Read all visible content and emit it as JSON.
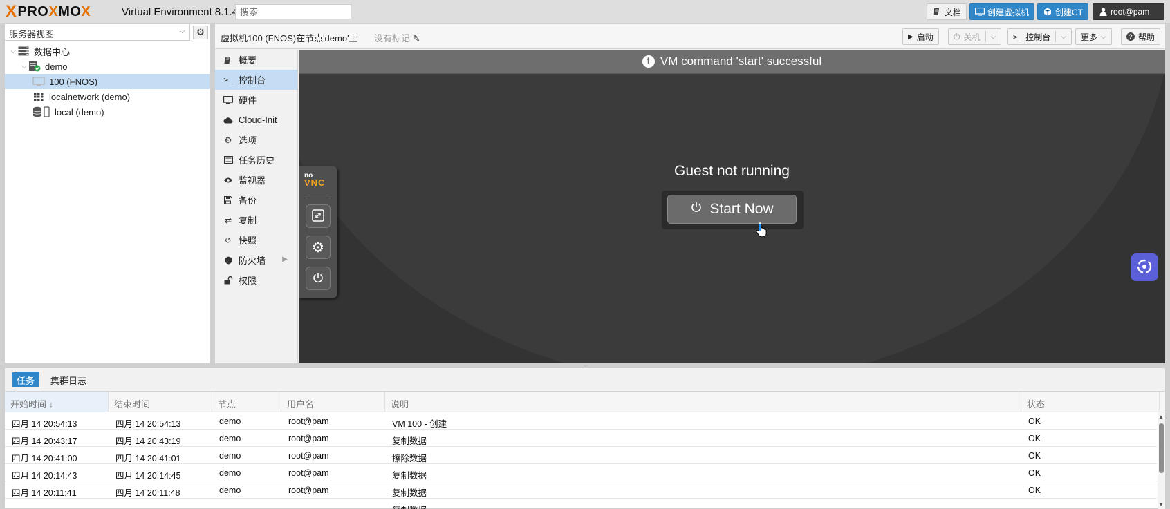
{
  "header": {
    "logo_text": "PROXMOX",
    "version": "Virtual Environment 8.1.4",
    "search_placeholder": "搜索",
    "docs_label": "文档",
    "create_vm_label": "创建虚拟机",
    "create_ct_label": "创建CT",
    "user_label": "root@pam"
  },
  "sidebar": {
    "view_label": "服务器视图",
    "tree": [
      {
        "label": "数据中心",
        "icon": "datacenter-icon"
      },
      {
        "label": "demo",
        "icon": "node-online-icon"
      },
      {
        "label": "100 (FNOS)",
        "icon": "vm-stopped-icon",
        "selected": true
      },
      {
        "label": "localnetwork (demo)",
        "icon": "network-grid-icon"
      },
      {
        "label": "local (demo)",
        "icon": "storage-icon"
      }
    ]
  },
  "content": {
    "title": "虚拟机100 (FNOS)在节点'demo'上",
    "no_tags": "没有标记",
    "buttons": {
      "start": "启动",
      "shutdown": "关机",
      "console": "控制台",
      "more": "更多",
      "help": "帮助"
    },
    "menu": [
      {
        "label": "概要",
        "icon": "book-icon"
      },
      {
        "label": "控制台",
        "icon": "terminal-icon",
        "selected": true
      },
      {
        "label": "硬件",
        "icon": "monitor-icon"
      },
      {
        "label": "Cloud-Init",
        "icon": "cloud-icon"
      },
      {
        "label": "选项",
        "icon": "gear-icon"
      },
      {
        "label": "任务历史",
        "icon": "list-icon"
      },
      {
        "label": "监视器",
        "icon": "eye-icon"
      },
      {
        "label": "备份",
        "icon": "floppy-icon"
      },
      {
        "label": "复制",
        "icon": "retweet-icon"
      },
      {
        "label": "快照",
        "icon": "history-icon"
      },
      {
        "label": "防火墙",
        "icon": "shield-icon",
        "has_submenu": true
      },
      {
        "label": "权限",
        "icon": "unlock-icon"
      }
    ],
    "console": {
      "message": "VM command 'start' successful",
      "novnc_no": "no",
      "novnc_vnc": "VNC",
      "guest_status": "Guest not running",
      "start_now": "Start Now"
    }
  },
  "tasks": {
    "tabs": [
      "任务",
      "集群日志"
    ],
    "columns": [
      "开始时间 ↓",
      "结束时间",
      "节点",
      "用户名",
      "说明",
      "状态"
    ],
    "rows": [
      [
        "四月 14 20:54:13",
        "四月 14 20:54:13",
        "demo",
        "root@pam",
        "VM 100 - 创建",
        "OK"
      ],
      [
        "四月 14 20:43:17",
        "四月 14 20:43:19",
        "demo",
        "root@pam",
        "复制数据",
        "OK"
      ],
      [
        "四月 14 20:41:00",
        "四月 14 20:41:01",
        "demo",
        "root@pam",
        "擦除数据",
        "OK"
      ],
      [
        "四月 14 20:14:43",
        "四月 14 20:14:45",
        "demo",
        "root@pam",
        "复制数据",
        "OK"
      ],
      [
        "四月 14 20:11:41",
        "四月 14 20:11:48",
        "demo",
        "root@pam",
        "复制数据",
        "OK"
      ],
      [
        "",
        "",
        "",
        "",
        "复制数据",
        ""
      ]
    ]
  },
  "colors": {
    "accent": "#2f87c9",
    "selection": "#c4ddf4",
    "brand_orange": "#e57000",
    "console_bg": "#333333"
  }
}
